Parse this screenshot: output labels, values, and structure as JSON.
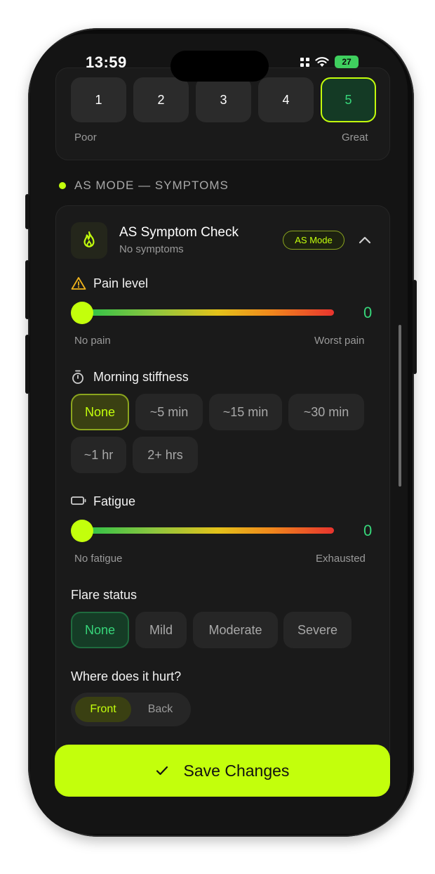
{
  "status": {
    "time": "13:59",
    "battery": "27"
  },
  "rating": {
    "options": [
      "1",
      "2",
      "3",
      "4",
      "5"
    ],
    "selected": "5",
    "low_label": "Poor",
    "high_label": "Great"
  },
  "section": {
    "header": "AS MODE — SYMPTOMS"
  },
  "symptom_card": {
    "title": "AS Symptom Check",
    "subtitle": "No symptoms",
    "badge": "AS Mode"
  },
  "pain": {
    "label": "Pain level",
    "value": "0",
    "min_label": "No pain",
    "max_label": "Worst pain"
  },
  "stiffness": {
    "label": "Morning stiffness",
    "options": [
      "None",
      "~5 min",
      "~15 min",
      "~30 min",
      "~1 hr",
      "2+ hrs"
    ],
    "selected": "None"
  },
  "fatigue": {
    "label": "Fatigue",
    "value": "0",
    "min_label": "No fatigue",
    "max_label": "Exhausted"
  },
  "flare": {
    "label": "Flare status",
    "options": [
      "None",
      "Mild",
      "Moderate",
      "Severe"
    ],
    "selected": "None"
  },
  "location": {
    "label": "Where does it hurt?",
    "options": [
      "Front",
      "Back"
    ],
    "selected": "Front"
  },
  "save": {
    "label": "Save Changes"
  },
  "colors": {
    "accent": "#c3ff0c",
    "success": "#37d67a",
    "background": "#141414",
    "card": "#1a1a1a"
  }
}
